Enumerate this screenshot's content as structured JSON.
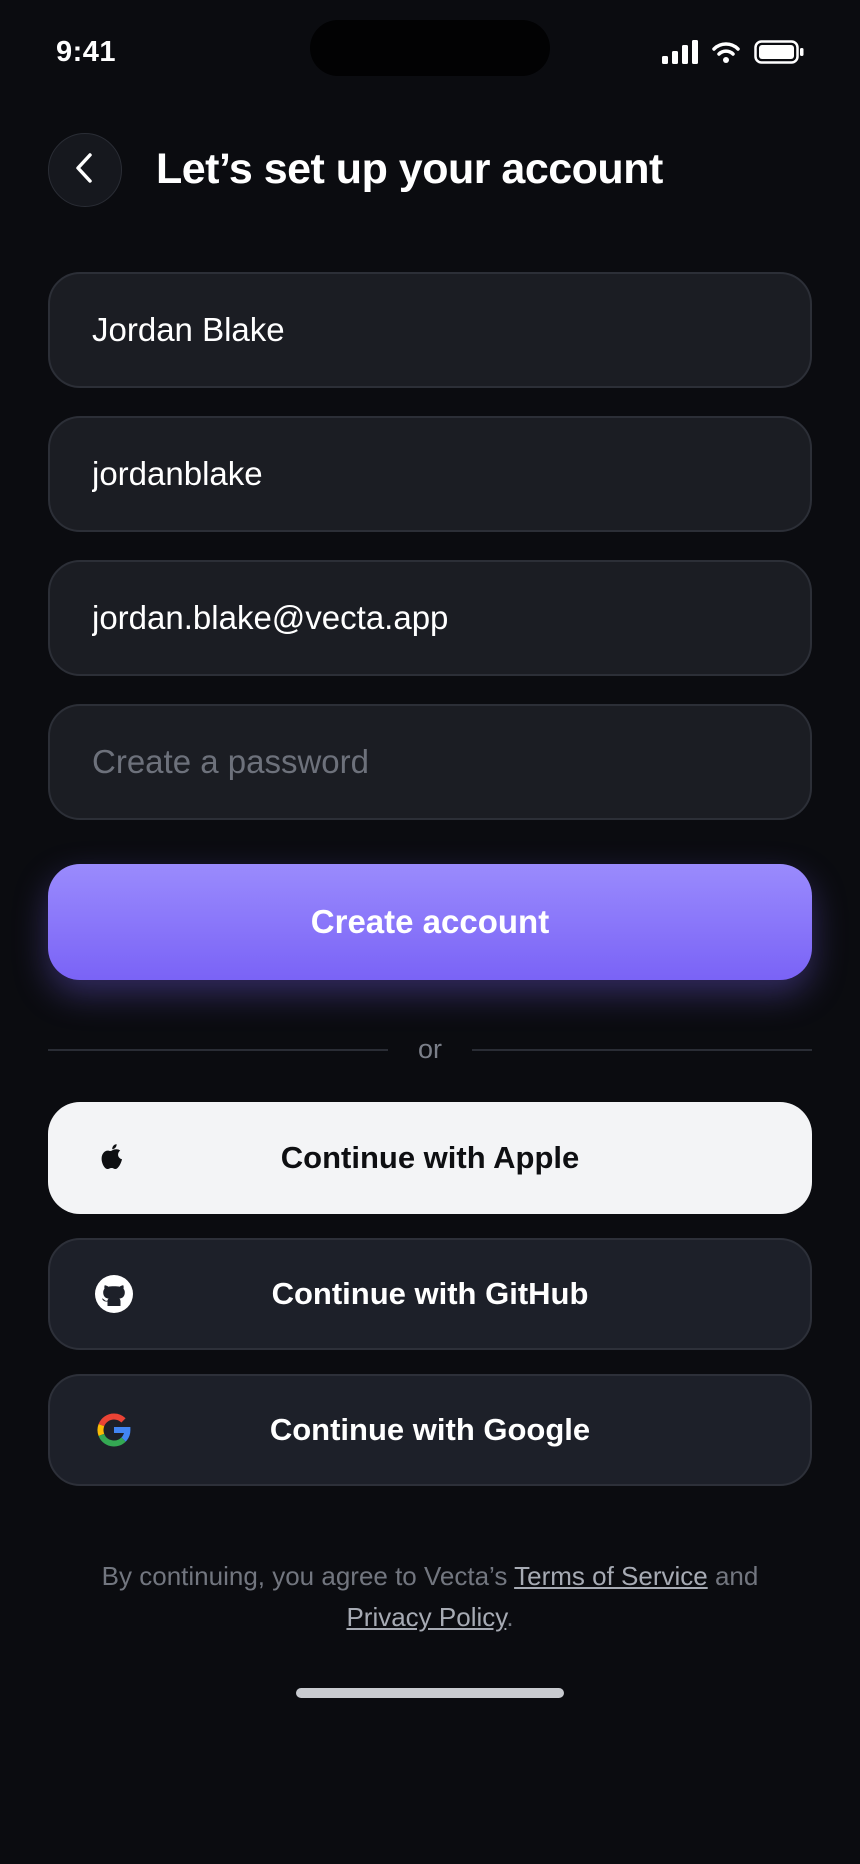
{
  "status_bar": {
    "time": "9:41"
  },
  "header": {
    "title": "Let’s set up your account"
  },
  "form": {
    "full_name": {
      "value": "Jordan Blake"
    },
    "username": {
      "value": "jordanblake"
    },
    "email": {
      "value": "jordan.blake@vecta.app"
    },
    "password": {
      "value": "",
      "placeholder": "Create a password"
    },
    "submit_label": "Create account"
  },
  "divider": {
    "label": "or"
  },
  "social": {
    "apple": "Continue with Apple",
    "github": "Continue with GitHub",
    "google": "Continue with Google"
  },
  "legal": {
    "prefix": "By continuing, you agree to Vecta’s ",
    "terms": "Terms of Service",
    "and": " and ",
    "privacy": "Privacy Policy",
    "suffix": "."
  },
  "colors": {
    "accent": "#8b77fb",
    "background": "#0b0c10",
    "field": "#1b1d23"
  },
  "icons": [
    "back-chevron-icon",
    "signal-icon",
    "wifi-icon",
    "battery-icon",
    "apple-icon",
    "github-icon",
    "google-icon"
  ]
}
